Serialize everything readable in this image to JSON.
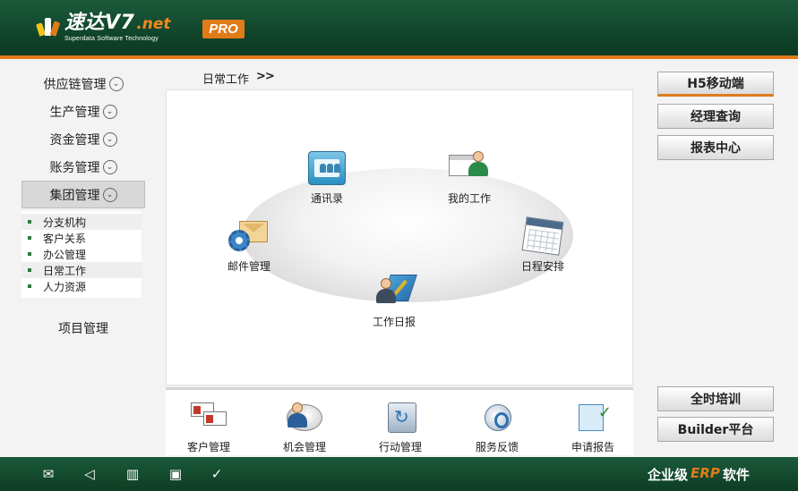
{
  "header": {
    "logo_title": "速达V7",
    "logo_suffix": ".net",
    "logo_subtitle": "Superdata Software Technology",
    "edition_badge": "PRO",
    "brand_colors": {
      "header_green": "#0f4229",
      "accent_orange": "#e07b1a"
    }
  },
  "sidebar": {
    "items": [
      {
        "label": "供应链管理"
      },
      {
        "label": "生产管理"
      },
      {
        "label": "资金管理"
      },
      {
        "label": "账务管理"
      },
      {
        "label": "集团管理"
      }
    ],
    "submenu": [
      {
        "label": "分支机构"
      },
      {
        "label": "客户关系"
      },
      {
        "label": "办公管理"
      },
      {
        "label": "日常工作"
      },
      {
        "label": "人力资源"
      }
    ],
    "project": "项目管理"
  },
  "breadcrumb": {
    "current": "日常工作",
    "arrow": ">>"
  },
  "main": {
    "nodes": {
      "contacts": "通讯录",
      "my_work": "我的工作",
      "mail": "邮件管理",
      "schedule": "日程安排",
      "daily_report": "工作日报"
    }
  },
  "bottom": {
    "items": [
      {
        "label": "客户管理",
        "icon": "customer-cards-icon"
      },
      {
        "label": "机会管理",
        "icon": "opportunity-icon"
      },
      {
        "label": "行动管理",
        "icon": "action-icon"
      },
      {
        "label": "服务反馈",
        "icon": "service-feedback-icon"
      },
      {
        "label": "申请报告",
        "icon": "report-icon"
      }
    ]
  },
  "right_buttons": {
    "mobile": "H5移动端",
    "manager_query": "经理查询",
    "report_center": "报表中心",
    "training": "全时培训",
    "builder": "Builder平台"
  },
  "footer": {
    "icons": [
      "mail-icon",
      "speaker-icon",
      "book-icon",
      "window-icon",
      "check-icon"
    ],
    "brand_prefix": "企业级",
    "brand_erp": "ERP",
    "brand_suffix": "软件"
  }
}
